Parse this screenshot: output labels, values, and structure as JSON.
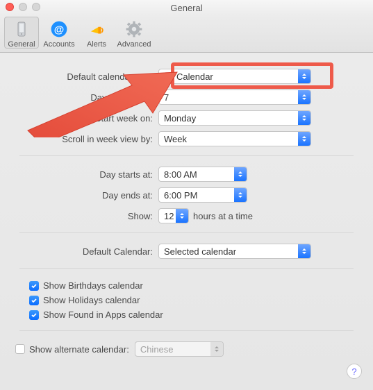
{
  "window": {
    "title": "General"
  },
  "toolbar": {
    "tabs": {
      "general": {
        "label": "General"
      },
      "accounts": {
        "label": "Accounts"
      },
      "alerts": {
        "label": "Alerts"
      },
      "advanced": {
        "label": "Advanced"
      }
    }
  },
  "settings": {
    "default_app": {
      "label": "Default calendar app:",
      "value": "Calendar"
    },
    "days_per_week": {
      "label": "Days per week:",
      "value": "7"
    },
    "start_week_on": {
      "label": "Start week on:",
      "value": "Monday"
    },
    "scroll_week_by": {
      "label": "Scroll in week view by:",
      "value": "Week"
    },
    "day_starts": {
      "label": "Day starts at:",
      "value": "8:00 AM"
    },
    "day_ends": {
      "label": "Day ends at:",
      "value": "6:00 PM"
    },
    "show_hours": {
      "label": "Show:",
      "value": "12",
      "suffix": "hours at a time"
    },
    "default_calendar": {
      "label": "Default Calendar:",
      "value": "Selected calendar"
    },
    "show_birthdays": {
      "label": "Show Birthdays calendar",
      "checked": true
    },
    "show_holidays": {
      "label": "Show Holidays calendar",
      "checked": true
    },
    "show_found_apps": {
      "label": "Show Found in Apps calendar",
      "checked": true
    },
    "alternate_cal": {
      "label": "Show alternate calendar:",
      "value": "Chinese",
      "checked": false
    }
  }
}
